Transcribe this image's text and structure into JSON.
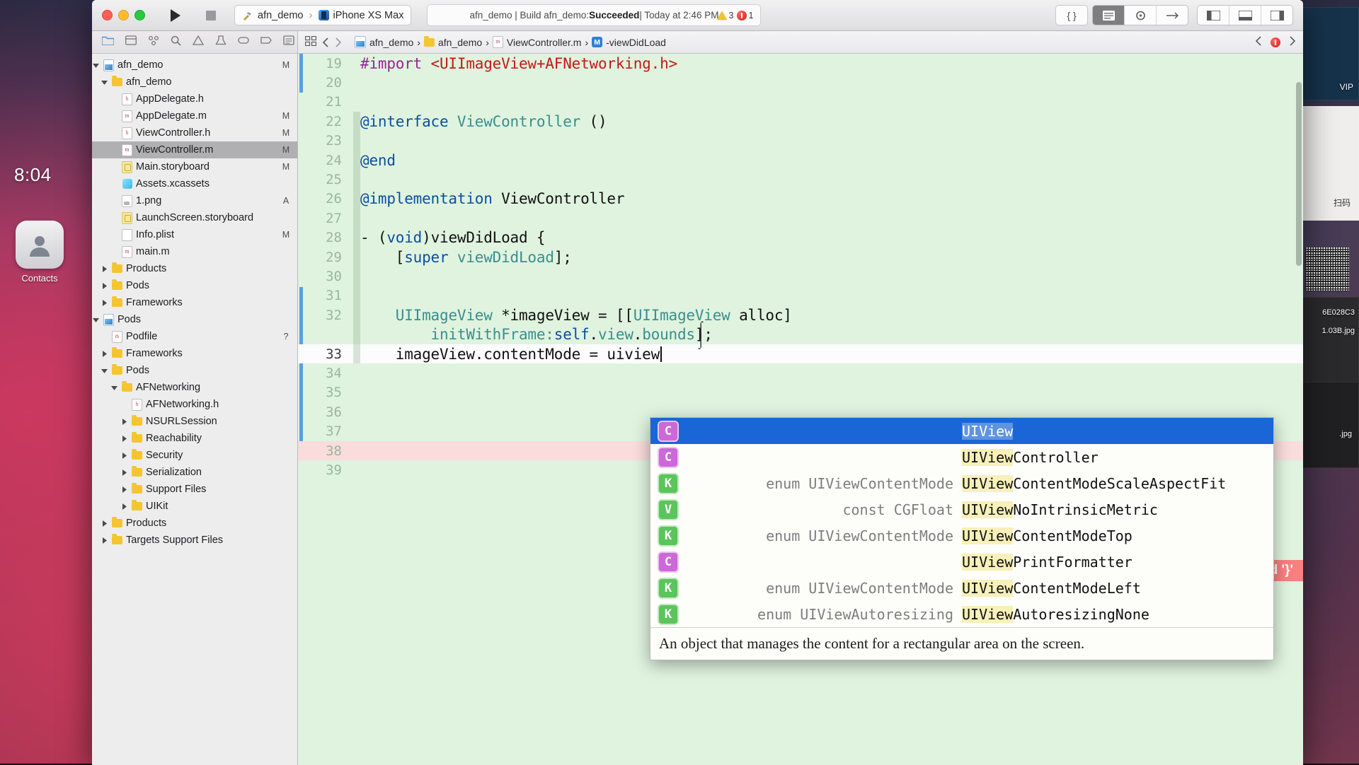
{
  "desktop": {
    "clock": "8:04",
    "apps": [
      {
        "name": "Contacts",
        "icon": "contacts-icon"
      }
    ],
    "right_items": [
      {
        "label": "VIP"
      },
      {
        "label": "扫码"
      },
      {
        "label": "6E028C3"
      },
      {
        "label": "1.03B.jpg"
      },
      {
        "label": ".jpg"
      }
    ]
  },
  "toolbar": {
    "run_label": "run-button",
    "stop_label": "stop-button",
    "scheme": {
      "project": "afn_demo",
      "separator": "›",
      "destination": "iPhone XS Max"
    },
    "status": {
      "prefix": "afn_demo | Build afn_demo: ",
      "result": "Succeeded",
      "suffix": " | Today at 2:46 PM"
    },
    "issues": {
      "warnings": "3",
      "errors": "1"
    },
    "library_label": "{ }",
    "accent_error": "#d0201c",
    "accent_warning": "#f2c327"
  },
  "navigator": {
    "toolbar_icons": [
      "folder-icon",
      "warning-triangle-icon",
      "search-icon",
      "issue-icon",
      "test-icon",
      "debug-icon",
      "breakpoint-icon",
      "report-icon"
    ],
    "items": [
      {
        "name": "afn_demo",
        "icon": "project-icon",
        "indent": 0,
        "twist": "down",
        "badge": "M"
      },
      {
        "name": "afn_demo",
        "icon": "folder-icon",
        "indent": 1,
        "twist": "down",
        "badge": ""
      },
      {
        "name": "AppDelegate.h",
        "icon": "header-file-icon",
        "indent": 2,
        "twist": "none",
        "badge": ""
      },
      {
        "name": "AppDelegate.m",
        "icon": "source-file-icon",
        "indent": 2,
        "twist": "none",
        "badge": "M"
      },
      {
        "name": "ViewController.h",
        "icon": "header-file-icon",
        "indent": 2,
        "twist": "none",
        "badge": "M"
      },
      {
        "name": "ViewController.m",
        "icon": "source-file-icon",
        "indent": 2,
        "twist": "none",
        "badge": "M",
        "selected": true
      },
      {
        "name": "Main.storyboard",
        "icon": "storyboard-icon",
        "indent": 2,
        "twist": "none",
        "badge": "M"
      },
      {
        "name": "Assets.xcassets",
        "icon": "assets-icon",
        "indent": 2,
        "twist": "none",
        "badge": ""
      },
      {
        "name": "1.png",
        "icon": "image-file-icon",
        "indent": 2,
        "twist": "none",
        "badge": "A"
      },
      {
        "name": "LaunchScreen.storyboard",
        "icon": "storyboard-icon",
        "indent": 2,
        "twist": "none",
        "badge": ""
      },
      {
        "name": "Info.plist",
        "icon": "plist-file-icon",
        "indent": 2,
        "twist": "none",
        "badge": "M"
      },
      {
        "name": "main.m",
        "icon": "source-file-icon",
        "indent": 2,
        "twist": "none",
        "badge": ""
      },
      {
        "name": "Products",
        "icon": "folder-icon",
        "indent": 1,
        "twist": "right",
        "badge": ""
      },
      {
        "name": "Pods",
        "icon": "folder-icon",
        "indent": 1,
        "twist": "right",
        "badge": ""
      },
      {
        "name": "Frameworks",
        "icon": "folder-icon",
        "indent": 1,
        "twist": "right",
        "badge": ""
      },
      {
        "name": "Pods",
        "icon": "project-icon",
        "indent": 0,
        "twist": "down",
        "badge": ""
      },
      {
        "name": "Podfile",
        "icon": "ruby-file-icon",
        "indent": 1,
        "twist": "none",
        "badge": "?"
      },
      {
        "name": "Frameworks",
        "icon": "folder-icon",
        "indent": 1,
        "twist": "right",
        "badge": ""
      },
      {
        "name": "Pods",
        "icon": "folder-icon",
        "indent": 1,
        "twist": "down",
        "badge": ""
      },
      {
        "name": "AFNetworking",
        "icon": "folder-icon",
        "indent": 2,
        "twist": "down",
        "badge": ""
      },
      {
        "name": "AFNetworking.h",
        "icon": "header-file-icon",
        "indent": 3,
        "twist": "none",
        "badge": ""
      },
      {
        "name": "NSURLSession",
        "icon": "folder-icon",
        "indent": 3,
        "twist": "right",
        "badge": ""
      },
      {
        "name": "Reachability",
        "icon": "folder-icon",
        "indent": 3,
        "twist": "right",
        "badge": ""
      },
      {
        "name": "Security",
        "icon": "folder-icon",
        "indent": 3,
        "twist": "right",
        "badge": ""
      },
      {
        "name": "Serialization",
        "icon": "folder-icon",
        "indent": 3,
        "twist": "right",
        "badge": ""
      },
      {
        "name": "Support Files",
        "icon": "folder-icon",
        "indent": 3,
        "twist": "right",
        "badge": ""
      },
      {
        "name": "UIKit",
        "icon": "folder-icon",
        "indent": 3,
        "twist": "right",
        "badge": ""
      },
      {
        "name": "Products",
        "icon": "folder-icon",
        "indent": 1,
        "twist": "right",
        "badge": ""
      },
      {
        "name": "Targets Support Files",
        "icon": "folder-icon",
        "indent": 1,
        "twist": "right",
        "badge": ""
      }
    ]
  },
  "jumpbar": {
    "crumbs": [
      {
        "label": "afn_demo",
        "icon": "project-icon"
      },
      {
        "label": "afn_demo",
        "icon": "folder-icon"
      },
      {
        "label": "ViewController.m",
        "icon": "source-file-icon"
      },
      {
        "label": "-viewDidLoad",
        "icon": "method-badge-icon"
      }
    ],
    "separator": "›"
  },
  "editor": {
    "lines": [
      {
        "n": "19",
        "segments": [
          {
            "t": "#import ",
            "c": "pp"
          },
          {
            "t": "<UIImageView+AFNetworking.h>",
            "c": "str"
          }
        ]
      },
      {
        "n": "20",
        "segments": []
      },
      {
        "n": "21",
        "segments": []
      },
      {
        "n": "22",
        "segments": [
          {
            "t": "@interface ",
            "c": "kw"
          },
          {
            "t": "ViewController",
            "c": "t"
          },
          {
            "t": " ()",
            "c": "id"
          }
        ]
      },
      {
        "n": "23",
        "segments": []
      },
      {
        "n": "24",
        "segments": [
          {
            "t": "@end",
            "c": "kw"
          }
        ]
      },
      {
        "n": "25",
        "segments": []
      },
      {
        "n": "26",
        "segments": [
          {
            "t": "@implementation ",
            "c": "kw"
          },
          {
            "t": "ViewController",
            "c": "id"
          }
        ]
      },
      {
        "n": "27",
        "segments": []
      },
      {
        "n": "28",
        "segments": [
          {
            "t": "- (",
            "c": "id"
          },
          {
            "t": "void",
            "c": "kw"
          },
          {
            "t": ")viewDidLoad {",
            "c": "id"
          }
        ]
      },
      {
        "n": "29",
        "segments": [
          {
            "t": "    [",
            "c": "id"
          },
          {
            "t": "super",
            "c": "kw"
          },
          {
            "t": " ",
            "c": "id"
          },
          {
            "t": "viewDidLoad",
            "c": "t"
          },
          {
            "t": "];",
            "c": "id"
          }
        ]
      },
      {
        "n": "30",
        "segments": []
      },
      {
        "n": "31",
        "segments": []
      },
      {
        "n": "32",
        "segments": [
          {
            "t": "    ",
            "c": "id"
          },
          {
            "t": "UIImageView",
            "c": "t"
          },
          {
            "t": " *imageView = [[",
            "c": "id"
          },
          {
            "t": "UIImageView",
            "c": "t"
          },
          {
            "t": " alloc]",
            "c": "id"
          }
        ]
      },
      {
        "n": "",
        "segments": [
          {
            "t": "        initWithFrame:",
            "c": "t"
          },
          {
            "t": "self",
            "c": "kw"
          },
          {
            "t": ".",
            "c": "id"
          },
          {
            "t": "view",
            "c": "t"
          },
          {
            "t": ".",
            "c": "id"
          },
          {
            "t": "bounds",
            "c": "t"
          },
          {
            "t": "];",
            "c": "id"
          }
        ]
      },
      {
        "n": "33",
        "segments": [
          {
            "t": "    imageView.contentMode = uiview",
            "c": "id"
          }
        ],
        "current": true
      },
      {
        "n": "34",
        "segments": []
      },
      {
        "n": "35",
        "segments": []
      },
      {
        "n": "36",
        "segments": []
      },
      {
        "n": "37",
        "segments": []
      },
      {
        "n": "38",
        "segments": [],
        "error": true
      },
      {
        "n": "39",
        "segments": []
      }
    ],
    "error_annotation": "Expected '}'",
    "background": "#dff3df"
  },
  "autocomplete": {
    "items": [
      {
        "kind": "C",
        "left": "",
        "prefix": "UIView",
        "rest": "",
        "selected": true
      },
      {
        "kind": "C",
        "left": "",
        "prefix": "UIView",
        "rest": "Controller"
      },
      {
        "kind": "K",
        "left": "enum UIViewContentMode",
        "prefix": "UIView",
        "rest": "ContentModeScaleAspectFit"
      },
      {
        "kind": "V",
        "left": "const CGFloat",
        "prefix": "UIView",
        "rest": "NoIntrinsicMetric"
      },
      {
        "kind": "K",
        "left": "enum UIViewContentMode",
        "prefix": "UIView",
        "rest": "ContentModeTop"
      },
      {
        "kind": "C",
        "left": "",
        "prefix": "UIView",
        "rest": "PrintFormatter"
      },
      {
        "kind": "K",
        "left": "enum UIViewContentMode",
        "prefix": "UIView",
        "rest": "ContentModeLeft"
      },
      {
        "kind": "K",
        "left": "enum UIViewAutoresizing",
        "prefix": "UIView",
        "rest": "AutoresizingNone"
      }
    ],
    "description": "An object that manages the content for a rectangular area on the screen."
  }
}
